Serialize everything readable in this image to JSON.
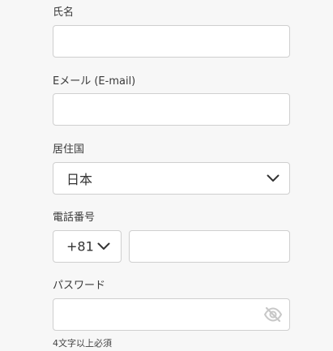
{
  "form": {
    "name": {
      "label": "氏名",
      "value": ""
    },
    "email": {
      "label": "Eメール (E-mail)",
      "value": ""
    },
    "country": {
      "label": "居住国",
      "selected": "日本"
    },
    "phone": {
      "label": "電話番号",
      "country_code": "+81",
      "value": ""
    },
    "password": {
      "label": "パスワード",
      "value": "",
      "hint": "4文字以上必須",
      "toggle_icon": "eye-off-icon"
    }
  },
  "colors": {
    "background": "#f7f7f7",
    "border": "#cfcfcf",
    "text": "#333333",
    "icon_muted": "#c8c8c8"
  }
}
